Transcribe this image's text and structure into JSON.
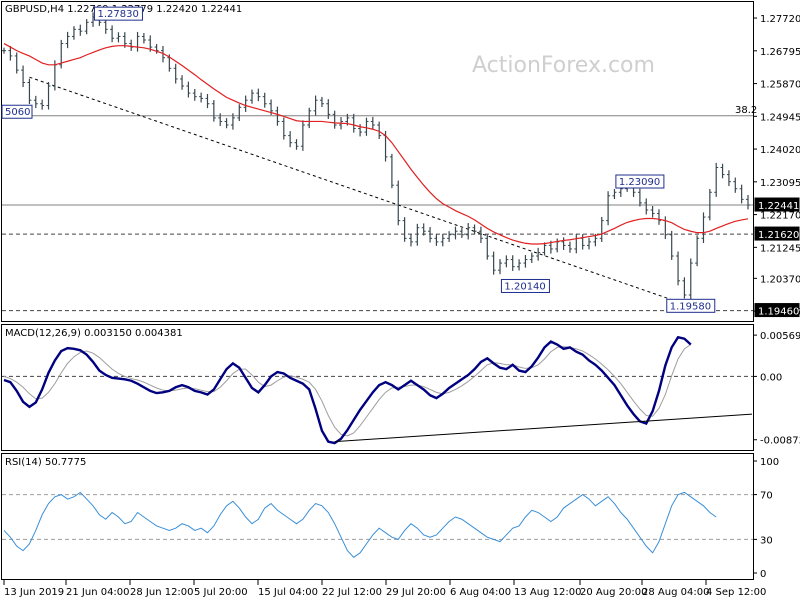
{
  "header": {
    "symbol_line": "GBPUSD,H4  1.22769 1.22779 1.22420 1.22441",
    "watermark": "ActionForex.com"
  },
  "colors": {
    "price_bars": "#37474f",
    "ma_line": "#e02020",
    "macd_line": "#000080",
    "signal_line": "#9e9e9e",
    "rsi_line": "#3a8fd8",
    "label_border": "#1f2e8f",
    "grid_dashed": "#555555"
  },
  "chart_data": [
    {
      "type": "line",
      "name": "price",
      "title": "GBPUSD,H4  1.22769 1.22779 1.22420 1.22441",
      "x_ticks": [
        "13 Jun 2019",
        "21 Jun 04:00",
        "28 Jun 12:00",
        "5 Jul 20:00",
        "15 Jul 04:00",
        "22 Jul 12:00",
        "29 Jul 20:00",
        "6 Aug 04:00",
        "13 Aug 12:00",
        "20 Aug 20:00",
        "28 Aug 04:00",
        "4 Sep 12:00"
      ],
      "y_ticks": [
        "1.27720",
        "1.26795",
        "1.25870",
        "1.24945",
        "1.24020",
        "1.23095",
        "1.22170",
        "1.21245",
        "1.20370",
        "1.19445"
      ],
      "ylim": [
        1.1925,
        1.2806
      ],
      "series": [
        {
          "values": [
            1.268,
            1.2665,
            1.2625,
            1.259,
            1.254,
            1.253,
            1.2525,
            1.258,
            1.264,
            1.27,
            1.272,
            1.274,
            1.2735,
            1.276,
            1.2775,
            1.276,
            1.274,
            1.2715,
            1.272,
            1.27,
            1.269,
            1.272,
            1.271,
            1.269,
            1.268,
            1.266,
            1.263,
            1.26,
            1.258,
            1.256,
            1.255,
            1.2545,
            1.253,
            1.249,
            1.248,
            1.247,
            1.249,
            1.252,
            1.254,
            1.256,
            1.255,
            1.253,
            1.251,
            1.248,
            1.244,
            1.242,
            1.241,
            1.247,
            1.251,
            1.254,
            1.253,
            1.25,
            1.247,
            1.248,
            1.249,
            1.246,
            1.245,
            1.248,
            1.247,
            1.244,
            1.238,
            1.23,
            1.22,
            1.215,
            1.214,
            1.218,
            1.217,
            1.215,
            1.214,
            1.215,
            1.216,
            1.217,
            1.216,
            1.218,
            1.217,
            1.215,
            1.21,
            1.206,
            1.208,
            1.209,
            1.207,
            1.208,
            1.209,
            1.21,
            1.211,
            1.213,
            1.212,
            1.214,
            1.213,
            1.212,
            1.215,
            1.213,
            1.214,
            1.215,
            1.22,
            1.227,
            1.228,
            1.229,
            1.23,
            1.228,
            1.225,
            1.223,
            1.222,
            1.22,
            1.216,
            1.21,
            1.203,
            1.199,
            1.208,
            1.215,
            1.221,
            1.228,
            1.235,
            1.233,
            1.231,
            1.229,
            1.226,
            1.2244
          ]
        },
        {
          "name": "MA",
          "values": [
            1.27,
            1.269,
            1.268,
            1.2672,
            1.2665,
            1.2655,
            1.2645,
            1.264,
            1.264,
            1.2645,
            1.265,
            1.2655,
            1.266,
            1.2668,
            1.2675,
            1.2682,
            1.2688,
            1.2692,
            1.2694,
            1.2694,
            1.2692,
            1.269,
            1.2688,
            1.2684,
            1.2678,
            1.2672,
            1.2662,
            1.265,
            1.2638,
            1.2625,
            1.2612,
            1.2598,
            1.2585,
            1.2572,
            1.256,
            1.2548,
            1.254,
            1.2532,
            1.2525,
            1.252,
            1.2515,
            1.251,
            1.2505,
            1.25,
            1.2494,
            1.2488,
            1.2482,
            1.248,
            1.248,
            1.248,
            1.248,
            1.2478,
            1.2476,
            1.2475,
            1.2474,
            1.247,
            1.2465,
            1.2462,
            1.2458,
            1.2452,
            1.244,
            1.242,
            1.2395,
            1.237,
            1.2345,
            1.2322,
            1.23,
            1.228,
            1.2262,
            1.2248,
            1.2238,
            1.2228,
            1.222,
            1.2212,
            1.2202,
            1.219,
            1.2178,
            1.2168,
            1.216,
            1.2152,
            1.2145,
            1.214,
            1.2136,
            1.2134,
            1.2134,
            1.2135,
            1.2138,
            1.2141,
            1.2144,
            1.2146,
            1.2149,
            1.2152,
            1.2155,
            1.2158,
            1.2162,
            1.217,
            1.2178,
            1.2187,
            1.2195,
            1.22,
            1.2204,
            1.2206,
            1.2206,
            1.2204,
            1.22,
            1.2194,
            1.2184,
            1.2175,
            1.217,
            1.2166,
            1.2166,
            1.217,
            1.2178,
            1.2185,
            1.2192,
            1.2198,
            1.2202,
            1.2205
          ]
        }
      ],
      "levels": [
        {
          "value": 1.2496,
          "label": "38.2",
          "style": "solid"
        },
        {
          "value": 1.2244,
          "label": "",
          "style": "solid"
        },
        {
          "value": 1.2162,
          "label": "",
          "style": "dashed"
        },
        {
          "value": 1.1946,
          "label": "",
          "style": "dashed"
        }
      ],
      "price_tags": [
        {
          "text": "1.22441",
          "value": 1.2244
        },
        {
          "text": "1.21620",
          "value": 1.2162
        },
        {
          "text": "1.19460",
          "value": 1.1946
        }
      ],
      "annotations": [
        {
          "text": "1.27830",
          "x": 18,
          "value": 1.2783
        },
        {
          "text": "1.20140",
          "x": 82,
          "value": 1.2014
        },
        {
          "text": "1.23090",
          "x": 100,
          "value": 1.2309
        },
        {
          "text": "1.19580",
          "x": 108,
          "value": 1.1958
        },
        {
          "text": "5060",
          "x": 0,
          "value": 1.2506
        }
      ],
      "trendline": {
        "x_start": 4,
        "y_start": 1.2605,
        "x_end": 108,
        "y_end": 1.1958
      }
    },
    {
      "type": "line",
      "name": "macd",
      "title": "MACD(12,26,9) 0.003150 0.004381",
      "y_ticks": [
        "0.005694",
        "0.00",
        "-0.008737"
      ],
      "ylim": [
        -0.0096,
        0.0064
      ],
      "series": [
        {
          "name": "MACD",
          "values": [
            -0.0005,
            -0.0008,
            -0.002,
            -0.0035,
            -0.0042,
            -0.0036,
            -0.0018,
            0.0005,
            0.0022,
            0.0035,
            0.0039,
            0.0038,
            0.0036,
            0.003,
            0.002,
            0.0008,
            0.0002,
            -0.0002,
            -0.0003,
            -0.0004,
            -0.0006,
            -0.001,
            -0.0015,
            -0.002,
            -0.0023,
            -0.0022,
            -0.002,
            -0.0015,
            -0.0012,
            -0.0015,
            -0.002,
            -0.0022,
            -0.0025,
            -0.0018,
            -0.0004,
            0.001,
            0.0018,
            0.0012,
            -0.0002,
            -0.0016,
            -0.0022,
            -0.0012,
            0.0,
            0.0006,
            0.0004,
            -0.0002,
            -0.0006,
            -0.001,
            -0.0018,
            -0.0045,
            -0.0075,
            -0.009,
            -0.0092,
            -0.0086,
            -0.0074,
            -0.006,
            -0.0046,
            -0.0034,
            -0.0022,
            -0.0012,
            -0.0008,
            -0.0012,
            -0.0018,
            -0.0012,
            -0.0006,
            -0.0012,
            -0.0018,
            -0.0026,
            -0.003,
            -0.0024,
            -0.0016,
            -0.001,
            -0.0004,
            0.0002,
            0.001,
            0.002,
            0.0025,
            0.0018,
            0.0012,
            0.001,
            0.0016,
            0.0008,
            0.0006,
            0.0014,
            0.0026,
            0.004,
            0.0048,
            0.0044,
            0.0038,
            0.004,
            0.0034,
            0.003,
            0.0022,
            0.0016,
            0.0008,
            -0.0002,
            -0.0012,
            -0.0026,
            -0.004,
            -0.0052,
            -0.0062,
            -0.0065,
            -0.0048,
            -0.002,
            0.0015,
            0.004,
            0.0054,
            0.0052,
            0.0044
          ]
        },
        {
          "name": "Signal",
          "values": [
            0.0,
            -0.0003,
            -0.0008,
            -0.0015,
            -0.0024,
            -0.0031,
            -0.003,
            -0.0022,
            -0.001,
            0.0005,
            0.0018,
            0.0027,
            0.0033,
            0.0035,
            0.0032,
            0.0026,
            0.0018,
            0.001,
            0.0004,
            0.0,
            -0.0003,
            -0.0005,
            -0.0008,
            -0.0012,
            -0.0016,
            -0.0019,
            -0.002,
            -0.0019,
            -0.0017,
            -0.0016,
            -0.0017,
            -0.0019,
            -0.0021,
            -0.0021,
            -0.0015,
            -0.0006,
            0.0004,
            0.001,
            0.001,
            0.0002,
            -0.0008,
            -0.0014,
            -0.0012,
            -0.0006,
            -0.0001,
            0.0001,
            -0.0001,
            -0.0004,
            -0.0008,
            -0.0018,
            -0.0034,
            -0.0054,
            -0.007,
            -0.008,
            -0.0082,
            -0.0078,
            -0.0068,
            -0.0056,
            -0.0044,
            -0.0032,
            -0.0022,
            -0.0016,
            -0.0015,
            -0.0014,
            -0.0012,
            -0.0012,
            -0.0014,
            -0.0018,
            -0.0022,
            -0.0024,
            -0.0022,
            -0.0018,
            -0.0013,
            -0.0007,
            0.0,
            0.0008,
            0.0016,
            0.0019,
            0.0018,
            0.0016,
            0.0016,
            0.0013,
            0.0011,
            0.0012,
            0.0016,
            0.0024,
            0.0034,
            0.004,
            0.0041,
            0.004,
            0.0038,
            0.0035,
            0.003,
            0.0024,
            0.0017,
            0.0009,
            0.0,
            -0.001,
            -0.0022,
            -0.0034,
            -0.0045,
            -0.0054,
            -0.0055,
            -0.0044,
            -0.0025,
            0.0001,
            0.0024,
            0.0038,
            0.0044
          ]
        }
      ],
      "trendline": {
        "x_start": 52,
        "y_start": -0.009,
        "x_end": 119,
        "y_end": -0.0052
      }
    },
    {
      "type": "line",
      "name": "rsi",
      "title": "RSI(14) 50.7775",
      "y_ticks": [
        "100",
        "70",
        "30",
        "0"
      ],
      "ylim": [
        0,
        100
      ],
      "levels": [
        70,
        30
      ],
      "series": [
        {
          "name": "RSI",
          "values": [
            38,
            32,
            24,
            20,
            26,
            38,
            52,
            62,
            68,
            70,
            66,
            68,
            72,
            66,
            60,
            52,
            48,
            54,
            50,
            44,
            46,
            54,
            50,
            46,
            42,
            40,
            38,
            40,
            44,
            42,
            38,
            40,
            36,
            42,
            52,
            60,
            64,
            58,
            50,
            44,
            48,
            58,
            62,
            56,
            52,
            48,
            44,
            48,
            56,
            62,
            60,
            54,
            44,
            32,
            20,
            14,
            18,
            26,
            34,
            40,
            36,
            32,
            30,
            38,
            44,
            40,
            34,
            32,
            34,
            40,
            46,
            50,
            48,
            44,
            40,
            36,
            32,
            30,
            28,
            34,
            40,
            42,
            50,
            56,
            54,
            50,
            46,
            50,
            58,
            62,
            66,
            70,
            66,
            60,
            64,
            68,
            62,
            54,
            48,
            40,
            32,
            24,
            18,
            28,
            44,
            60,
            70,
            72,
            68,
            64,
            60,
            54,
            50
          ]
        }
      ]
    }
  ],
  "x_axis": {
    "labels": [
      "13 Jun 2019",
      "21 Jun 04:00",
      "28 Jun 12:00",
      "5 Jul 20:00",
      "15 Jul 04:00",
      "22 Jul 12:00",
      "29 Jul 20:00",
      "6 Aug 04:00",
      "13 Aug 12:00",
      "20 Aug 20:00",
      "28 Aug 04:00",
      "4 Sep 12:00"
    ]
  }
}
